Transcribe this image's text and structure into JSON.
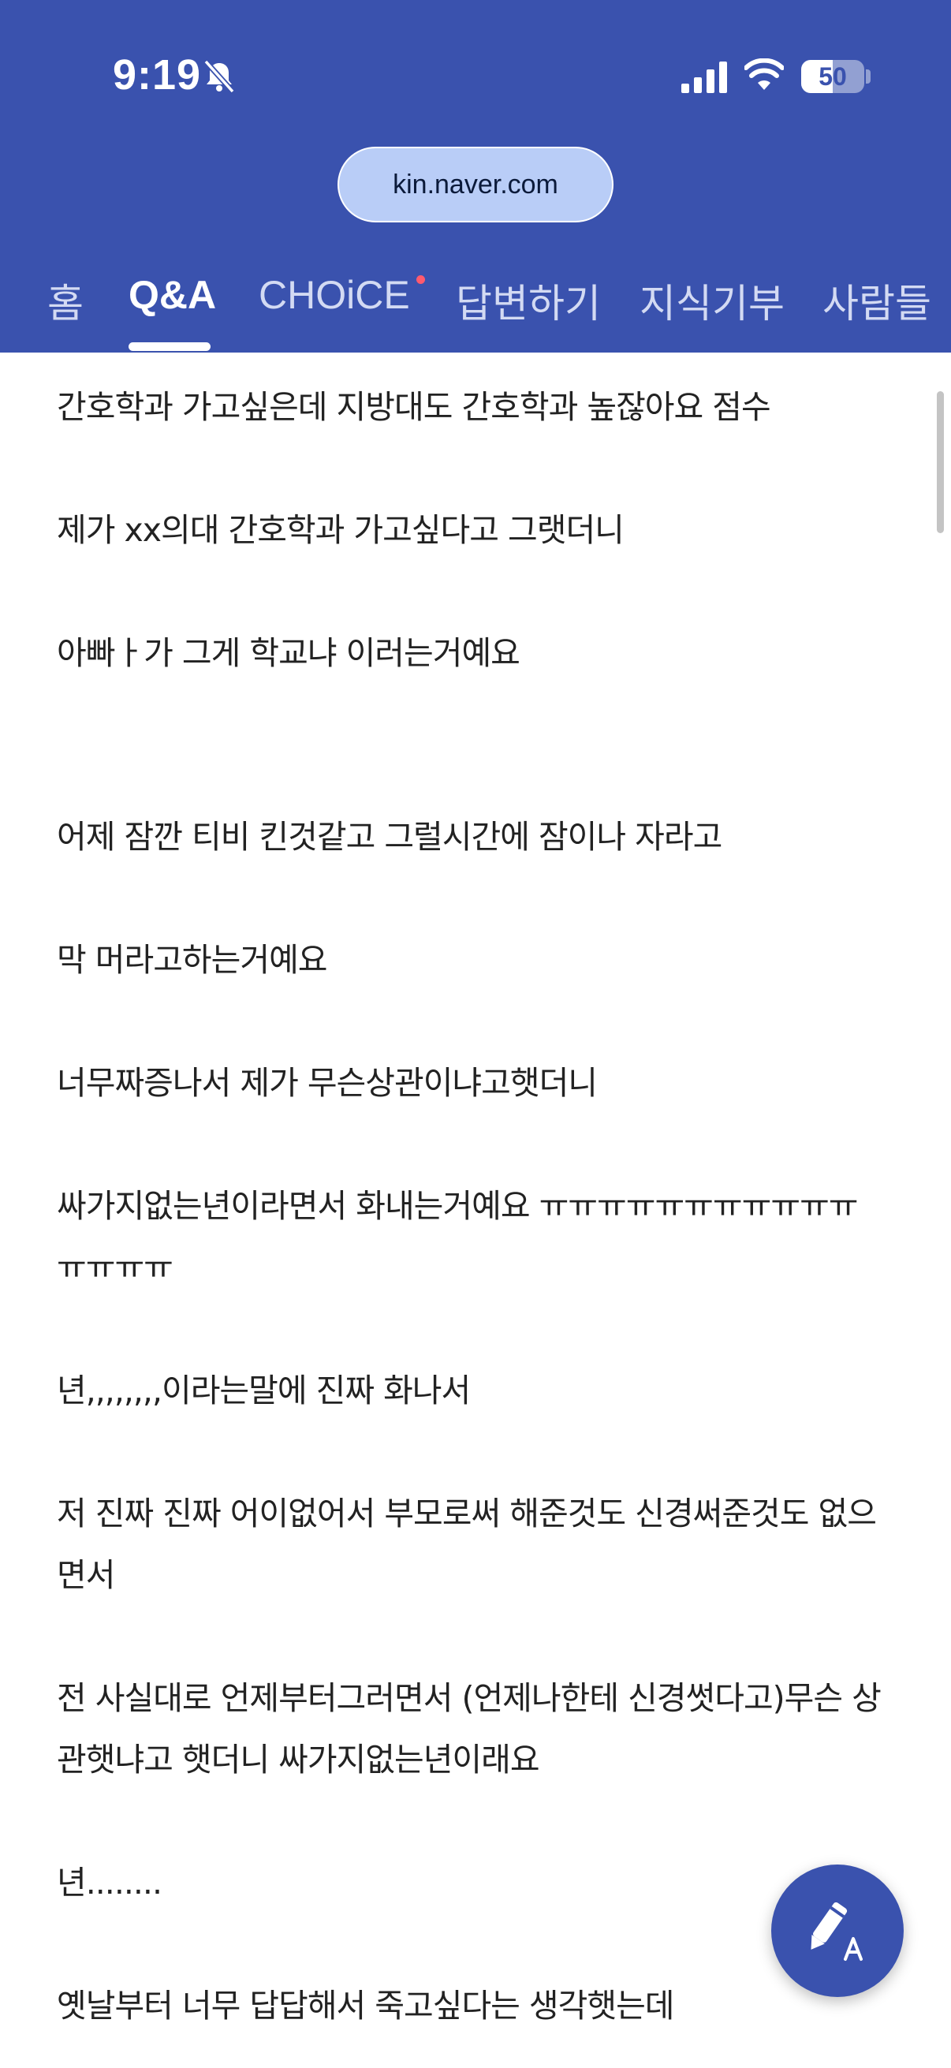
{
  "status_bar": {
    "time": "9:19",
    "battery": "50",
    "battery_level": 0.5
  },
  "browser": {
    "url": "kin.naver.com"
  },
  "tabs": [
    {
      "label": "홈",
      "active": false
    },
    {
      "label": "Q&A",
      "active": true
    },
    {
      "label": "CHOiCE",
      "active": false,
      "has_new_dot": true
    },
    {
      "label": "답변하기",
      "active": false
    },
    {
      "label": "지식기부",
      "active": false
    },
    {
      "label": "사람들",
      "active": false
    }
  ],
  "post": {
    "paragraphs": [
      "간호학과 가고싶은데 지방대도 간호학과  높잖아요 점수",
      "제가 xx의대 간호학과 가고싶다고 그랫더니",
      "아빠ㅏ가 그게 학교냐 이러는거예요",
      "어제 잠깐 티비 킨것같고 그럴시간에 잠이나 자라고",
      "막 머라고하는거예요",
      "너무짜증나서 제가 무슨상관이냐고햇더니",
      "싸가지없는년이라면서 화내는거예요 ㅠㅠㅠㅠㅠㅠㅠㅠㅠㅠㅠㅠㅠㅠㅠ",
      "년,,,,,,,,이라는말에 진짜 화나서",
      "저 진짜 진짜 어이없어서 부모로써 해준것도 신경써준것도 없으면서",
      "전 사실대로 언제부터그러면서 (언제나한테 신경썻다고)무슨 상관햇냐고 햇더니 싸가지없는년이래요",
      "년........",
      "옛날부터 너무 답답해서 죽고싶다는 생각햇는데"
    ]
  },
  "colors": {
    "brand": "#3a52ae",
    "url_pill": "#b9cdf7",
    "new_dot": "#ff5a6e",
    "body_text": "#222222"
  },
  "icons": {
    "bell": "bell-slash-icon",
    "signal": "signal-bars-icon",
    "wifi": "wifi-icon",
    "fab": "pencil-write-icon"
  }
}
